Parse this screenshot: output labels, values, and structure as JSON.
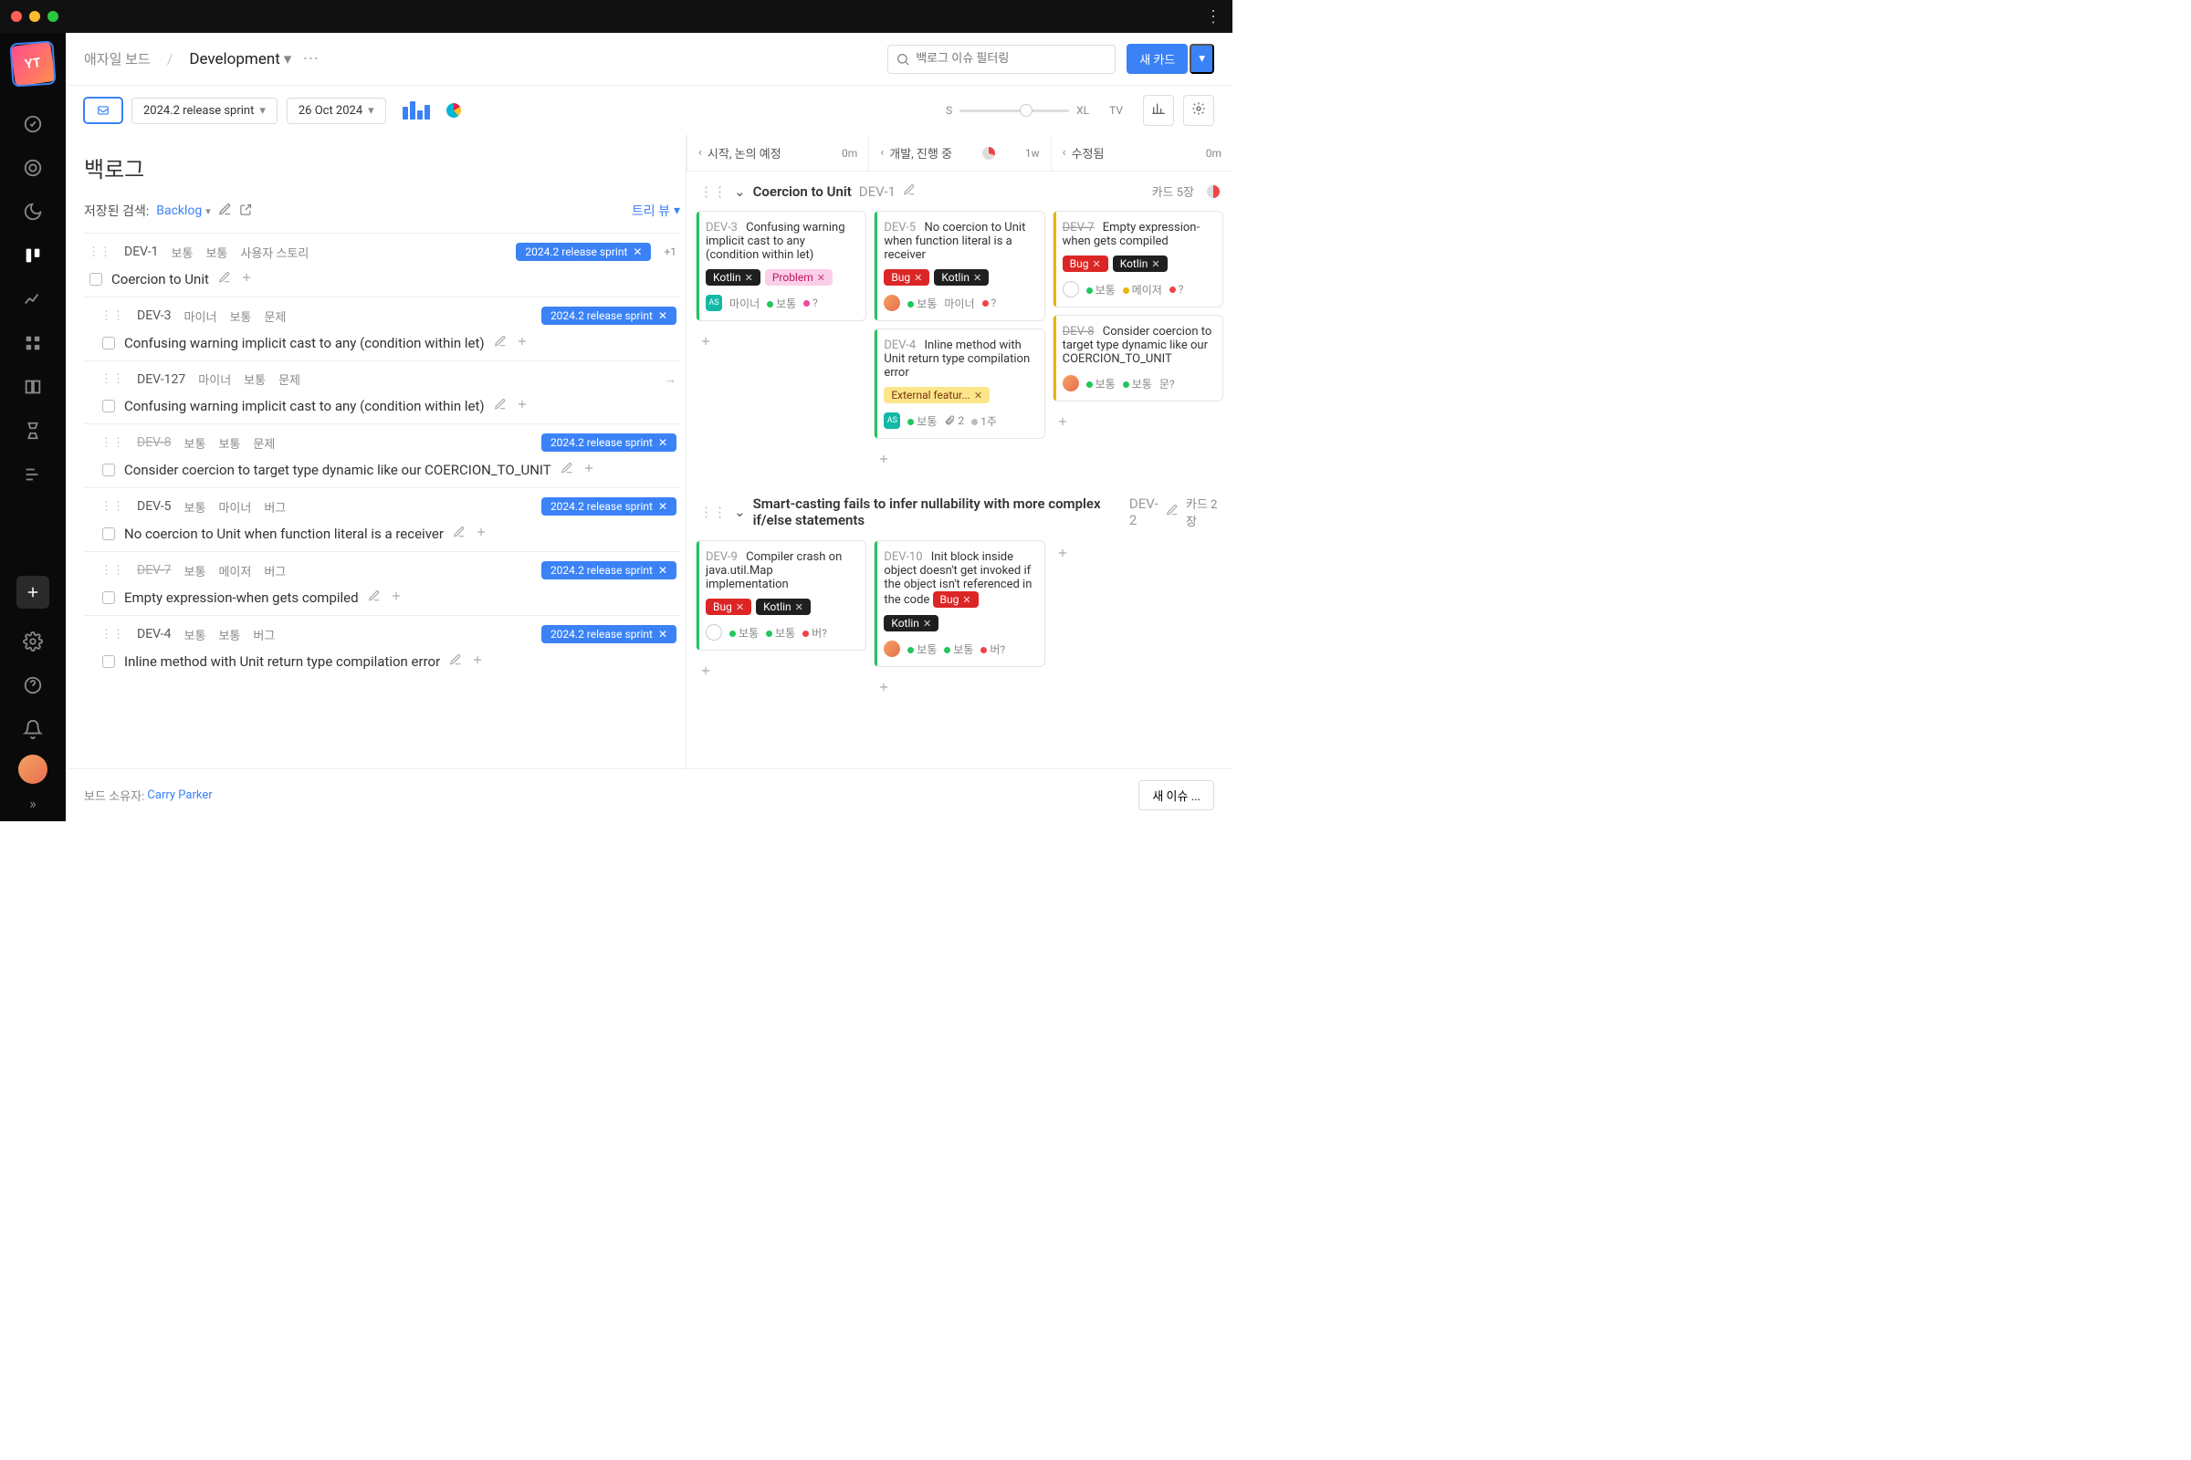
{
  "breadcrumb": {
    "root": "애자일 보드",
    "board": "Development"
  },
  "search": {
    "placeholder": "백로그 이슈 필터링"
  },
  "buttons": {
    "newCard": "새 카드",
    "newIssue": "새 이슈 ..."
  },
  "toolbar": {
    "sprint": "2024.2 release sprint",
    "date": "26 Oct 2024",
    "sizeS": "S",
    "sizeXL": "XL",
    "tv": "TV"
  },
  "backlog": {
    "title": "백로그",
    "savedSearchLabel": "저장된 검색:",
    "savedSearchName": "Backlog",
    "treeView": "트리 뷰",
    "sprintPill": "2024.2 release sprint",
    "plusOne": "+1"
  },
  "backlogItems": [
    {
      "id": "DEV-1",
      "metas": [
        "보통",
        "보통",
        "사용자 스토리"
      ],
      "title": "Coercion to Unit",
      "hasSprint": true,
      "plusOne": true,
      "struck": false,
      "child": false,
      "arrow": false
    },
    {
      "id": "DEV-3",
      "metas": [
        "마이너",
        "보통",
        "문제"
      ],
      "title": "Confusing warning implicit cast to any (condition within let)",
      "hasSprint": true,
      "struck": false,
      "child": true,
      "arrow": false
    },
    {
      "id": "DEV-127",
      "metas": [
        "마이너",
        "보통",
        "문제"
      ],
      "title": "Confusing warning implicit cast to any (condition within let)",
      "hasSprint": false,
      "struck": false,
      "child": true,
      "arrow": true
    },
    {
      "id": "DEV-8",
      "metas": [
        "보통",
        "보통",
        "문제"
      ],
      "title": "Consider coercion to target type dynamic like our COERCION_TO_UNIT",
      "hasSprint": true,
      "struck": true,
      "child": true,
      "arrow": false
    },
    {
      "id": "DEV-5",
      "metas": [
        "보통",
        "마이너",
        "버그"
      ],
      "title": "No coercion to Unit when function literal is a receiver",
      "hasSprint": true,
      "struck": false,
      "child": true,
      "arrow": false
    },
    {
      "id": "DEV-7",
      "metas": [
        "보통",
        "메이저",
        "버그"
      ],
      "title": "Empty expression-when gets compiled",
      "hasSprint": true,
      "struck": true,
      "child": true,
      "arrow": false
    },
    {
      "id": "DEV-4",
      "metas": [
        "보통",
        "보통",
        "버그"
      ],
      "title": "Inline method with Unit return type compilation error",
      "hasSprint": true,
      "struck": false,
      "child": true,
      "arrow": false
    }
  ],
  "columns": [
    {
      "name": "시작, 논의 예정",
      "estimate": "0m",
      "pie": false
    },
    {
      "name": "개발, 진행 중",
      "estimate": "1w",
      "pie": true
    },
    {
      "name": "수정됨",
      "estimate": "0m",
      "pie": false
    }
  ],
  "swimlanes": [
    {
      "name": "Coercion to Unit",
      "sid": "DEV-1",
      "count": "카드 5장",
      "pie": true,
      "cols": [
        [
          {
            "cid": "DEV-3",
            "struck": false,
            "title": "Confusing warning implicit cast to any (condition within let)",
            "tags": [
              {
                "t": "Kotlin",
                "c": "kotlin"
              },
              {
                "t": "Problem",
                "c": "problem"
              }
            ],
            "footer": {
              "avatar": "teal",
              "avatarText": "AS",
              "items": [
                {
                  "dot": "",
                  "text": "마이너"
                },
                {
                  "dot": "green",
                  "text": "보통"
                },
                {
                  "dot": "pink",
                  "text": "?"
                }
              ]
            },
            "stripe": "green"
          }
        ],
        [
          {
            "cid": "DEV-5",
            "struck": false,
            "title": "No coercion to Unit when function literal is a receiver",
            "tags": [
              {
                "t": "Bug",
                "c": "bug"
              },
              {
                "t": "Kotlin",
                "c": "kotlin"
              }
            ],
            "footer": {
              "avatar": "img",
              "items": [
                {
                  "dot": "green",
                  "text": "보통"
                },
                {
                  "dot": "",
                  "text": "마이너"
                },
                {
                  "dot": "red",
                  "text": "?"
                }
              ]
            },
            "stripe": "green"
          },
          {
            "cid": "DEV-4",
            "struck": false,
            "title": "Inline method with Unit return type compilation error",
            "tags": [
              {
                "t": "External featur...",
                "c": "ext"
              }
            ],
            "footer": {
              "avatar": "teal",
              "avatarText": "AS",
              "items": [
                {
                  "dot": "green",
                  "text": "보통"
                },
                {
                  "attach": "2"
                },
                {
                  "dot": "gray",
                  "text": "1주"
                }
              ]
            },
            "stripe": "green"
          }
        ],
        [
          {
            "cid": "DEV-7",
            "struck": true,
            "title": "Empty expression-when gets compiled",
            "tags": [
              {
                "t": "Bug",
                "c": "bug"
              },
              {
                "t": "Kotlin",
                "c": "kotlin"
              }
            ],
            "footer": {
              "avatar": "outline",
              "items": [
                {
                  "dot": "green",
                  "text": "보통"
                },
                {
                  "dot": "yellow",
                  "text": "메이저"
                },
                {
                  "dot": "red",
                  "text": "?"
                }
              ]
            },
            "stripe": "yellow"
          },
          {
            "cid": "DEV-8",
            "struck": true,
            "title": "Consider coercion to target type dynamic like our COERCION_TO_UNIT",
            "tags": [],
            "footer": {
              "avatar": "img",
              "items": [
                {
                  "dot": "green",
                  "text": "보통"
                },
                {
                  "dot": "green",
                  "text": "보통"
                },
                {
                  "dot": "",
                  "text": "문?"
                }
              ]
            },
            "stripe": "yellow"
          }
        ]
      ]
    },
    {
      "name": "Smart-casting fails to infer nullability with more complex if/else statements",
      "sid": "DEV-2",
      "count": "카드 2장",
      "pie": false,
      "cols": [
        [
          {
            "cid": "DEV-9",
            "struck": false,
            "title": "Compiler crash on java.util.Map implementation",
            "tags": [
              {
                "t": "Bug",
                "c": "bug"
              },
              {
                "t": "Kotlin",
                "c": "kotlin"
              }
            ],
            "footer": {
              "avatar": "outline",
              "items": [
                {
                  "dot": "green",
                  "text": "보통"
                },
                {
                  "dot": "green",
                  "text": "보통"
                },
                {
                  "dot": "red",
                  "text": "버?"
                }
              ]
            },
            "stripe": "green"
          }
        ],
        [
          {
            "cid": "DEV-10",
            "struck": false,
            "title": "Init block inside object doesn't get invoked if the object isn't referenced in the code",
            "tags": [
              {
                "t": "Bug",
                "c": "bug",
                "inline": true
              },
              {
                "t": "Kotlin",
                "c": "kotlin"
              }
            ],
            "footer": {
              "avatar": "img",
              "items": [
                {
                  "dot": "green",
                  "text": "보통"
                },
                {
                  "dot": "green",
                  "text": "보통"
                },
                {
                  "dot": "red",
                  "text": "버?"
                }
              ]
            },
            "stripe": "green"
          }
        ],
        []
      ]
    }
  ],
  "footer": {
    "ownerLabel": "보드 소유자:",
    "ownerName": "Carry Parker"
  }
}
